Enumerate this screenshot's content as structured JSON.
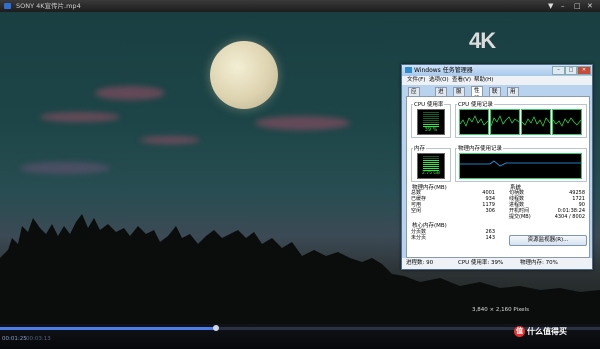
{
  "player": {
    "title": "SONY 4K宣传片.mp4",
    "window_controls": [
      "▼",
      "–",
      "□",
      "✕"
    ],
    "badge": "4K",
    "resolution": "3,840 × 2,160 Pixels",
    "current_time": "00:01:25",
    "total_time": "00:03:13",
    "progress": 0.36
  },
  "taskmanager": {
    "title": "Windows 任务管理器",
    "window_buttons": [
      "–",
      "□",
      "✕"
    ],
    "menu": [
      "文件(F)",
      "选项(O)",
      "查看(V)",
      "帮助(H)"
    ],
    "tabs": [
      "应用程序",
      "进程",
      "服务",
      "性能",
      "联网",
      "用户"
    ],
    "selected_tab": "性能",
    "cpu_usage_label": "CPU 使用率",
    "cpu_usage_value": "39 %",
    "cpu_history_label": "CPU 使用记录",
    "memory_label": "内存",
    "memory_value": "2.75 GB",
    "memory_history_label": "物理内存使用记录",
    "physical_memory": {
      "title": "物理内存(MB)",
      "rows": [
        {
          "label": "总数",
          "value": "4001"
        },
        {
          "label": "已缓存",
          "value": "934"
        },
        {
          "label": "可用",
          "value": "1179"
        },
        {
          "label": "空闲",
          "value": "306"
        }
      ]
    },
    "kernel_memory": {
      "title": "核心内存(MB)",
      "rows": [
        {
          "label": "分页数",
          "value": "263"
        },
        {
          "label": "未分页",
          "value": "143"
        }
      ]
    },
    "system": {
      "title": "系统",
      "rows": [
        {
          "label": "句柄数",
          "value": "49258"
        },
        {
          "label": "线程数",
          "value": "1721"
        },
        {
          "label": "进程数",
          "value": "90"
        },
        {
          "label": "开机时间",
          "value": "0:01:38:24"
        },
        {
          "label": "提交(MB)",
          "value": "4304 / 8002"
        }
      ]
    },
    "resource_monitor_button": "资源监视器(R)...",
    "status": {
      "processes": "进程数: 90",
      "cpu": "CPU 使用率: 39%",
      "memory": "物理内存: 70%"
    }
  },
  "watermark": {
    "icon": "值",
    "text": "什么值得买"
  },
  "colors": {
    "graph_green": "#2ee84a",
    "memory_blue": "#2aa8ff",
    "progress_blue": "#4d7ee8"
  }
}
